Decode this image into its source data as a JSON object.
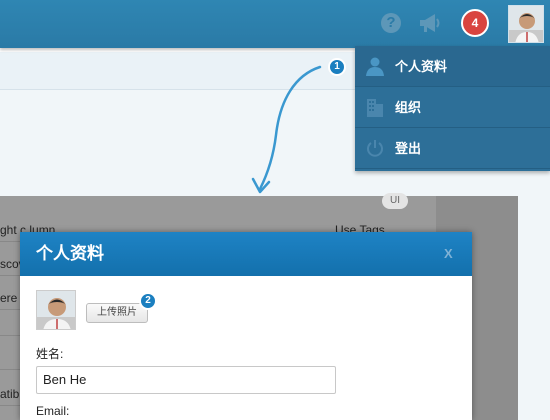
{
  "header": {
    "notification_count": "4",
    "icons": [
      "help-icon",
      "megaphone-icon",
      "user-avatar"
    ]
  },
  "dropdown": {
    "items": [
      {
        "label": "个人资料",
        "icon": "user-icon"
      },
      {
        "label": "组织",
        "icon": "building-icon"
      },
      {
        "label": "登出",
        "icon": "power-icon"
      }
    ]
  },
  "annotations": {
    "step1": "1",
    "step2": "2"
  },
  "background": {
    "pill": "UI",
    "rows": [
      {
        "left": "ght c  lumn",
        "right": "Use   Tags"
      },
      {
        "left": "scov",
        "right": ""
      },
      {
        "left": "ere",
        "right": ""
      },
      {
        "left": "",
        "right": ""
      },
      {
        "left": "",
        "right": ""
      },
      {
        "left": "atib",
        "right": ""
      }
    ]
  },
  "modal": {
    "title": "个人资料",
    "close_label": "X",
    "upload_button": "上传照片",
    "name_label": "姓名:",
    "name_value": "Ben He",
    "email_label": "Email:"
  },
  "colors": {
    "header": "#2f86b3",
    "dropdown": "#2d6f98",
    "modal_header": "#1878b8",
    "badge": "#d9443f",
    "step_badge": "#1b7fc0"
  }
}
